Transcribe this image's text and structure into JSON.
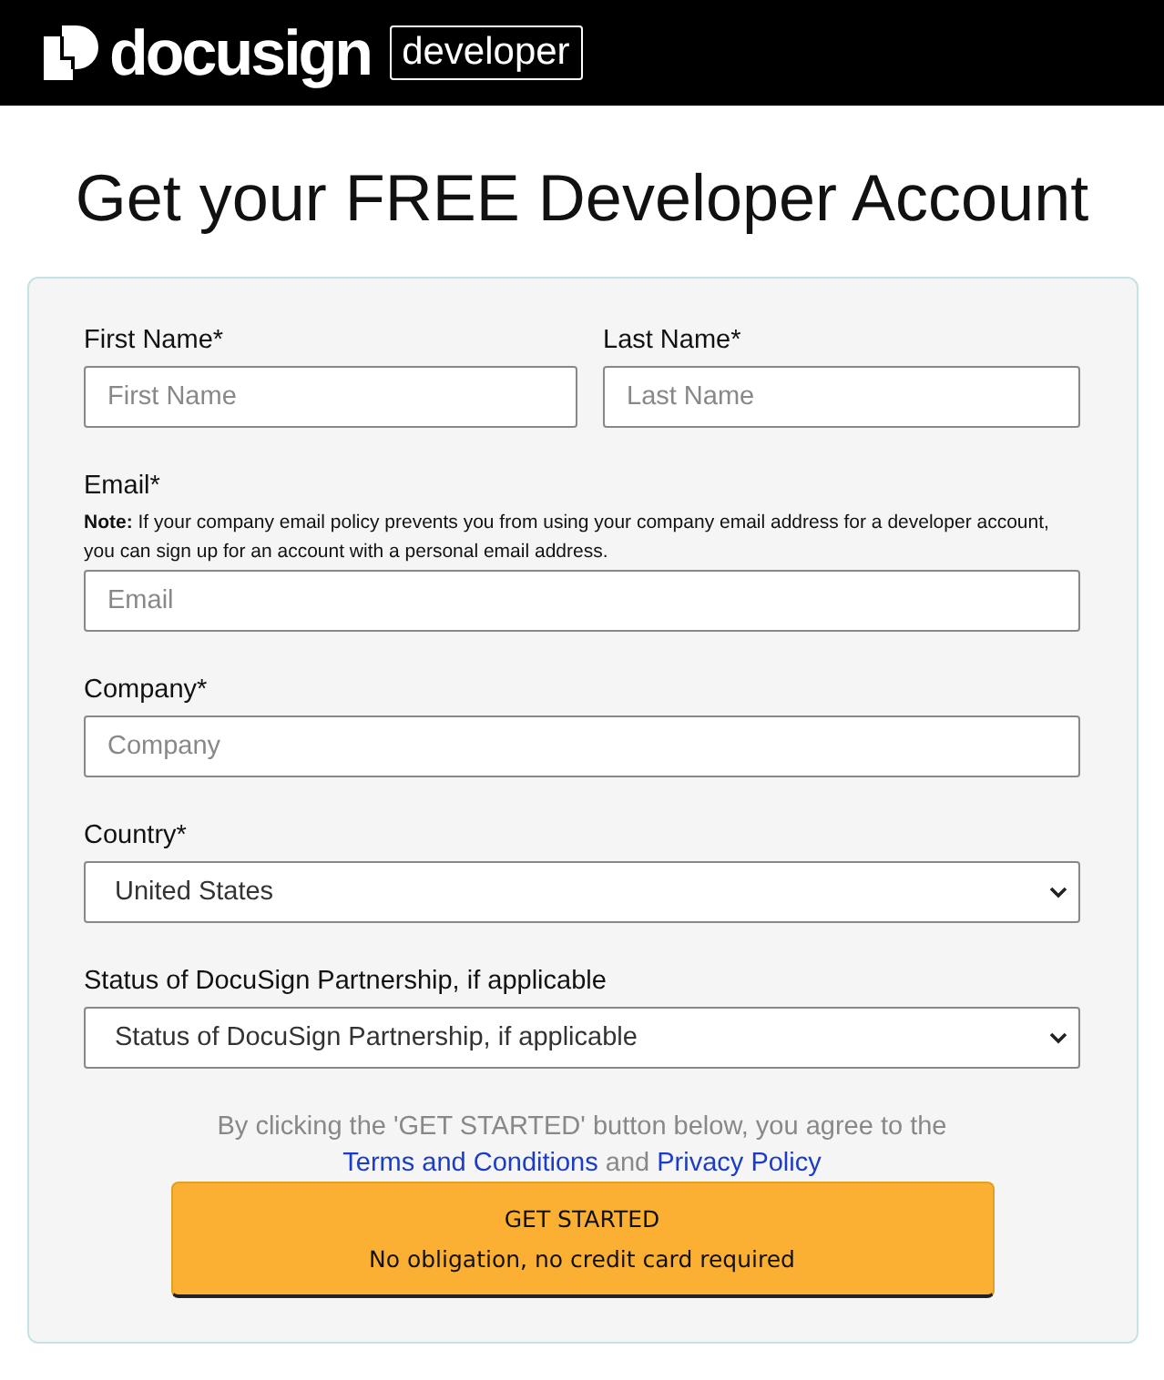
{
  "header": {
    "logo_text": "docusign",
    "badge": "developer"
  },
  "title": "Get your FREE Developer Account",
  "form": {
    "name_fields": [
      {
        "label": "First Name*",
        "placeholder": "First Name"
      },
      {
        "label": "Last Name*",
        "placeholder": "Last Name"
      }
    ],
    "email": {
      "label": "Email*",
      "note": "**Note:** If your company email policy prevents you from using your company email address for a developer account, you can sign up for an account with a personal email address.",
      "placeholder": "Email"
    },
    "company": {
      "label": "Company*",
      "placeholder": "Company"
    },
    "country": {
      "label": "Country*",
      "value": "United States"
    },
    "partnership": {
      "label": "Status of DocuSign Partnership, if applicable",
      "value": "Status of DocuSign Partnership, if applicable"
    },
    "agreement": {
      "before": "By clicking the 'GET STARTED' button below, you agree to the ",
      "terms_link": "Terms and Conditions",
      "middle": " and ",
      "privacy_link": "Privacy Policy"
    },
    "submit": {
      "label": "GET STARTED",
      "sublabel": "No obligation, no credit card required"
    }
  }
}
